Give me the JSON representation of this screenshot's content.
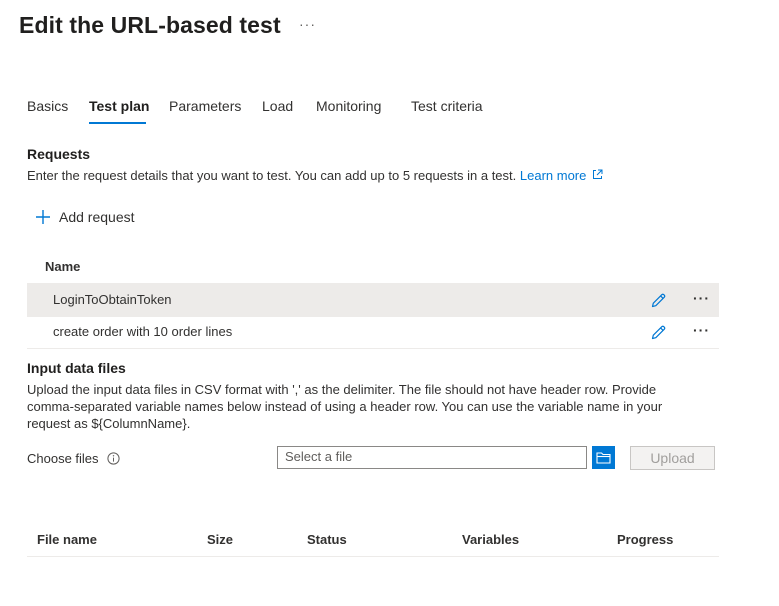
{
  "page": {
    "title": "Edit the URL-based test",
    "more_label": "···"
  },
  "tabs": [
    {
      "label": "Basics",
      "active": false
    },
    {
      "label": "Test plan",
      "active": true
    },
    {
      "label": "Parameters",
      "active": false
    },
    {
      "label": "Load",
      "active": false
    },
    {
      "label": "Monitoring",
      "active": false
    },
    {
      "label": "Test criteria",
      "active": false
    }
  ],
  "requests": {
    "title": "Requests",
    "description": "Enter the request details that you want to test. You can add up to 5 requests in a test.",
    "learn_more": "Learn more",
    "add_request": "Add request",
    "column_name": "Name",
    "rows": [
      {
        "name": "LoginToObtainToken",
        "selected": true
      },
      {
        "name": "create order with 10 order lines",
        "selected": false
      }
    ],
    "more_label": "···"
  },
  "input_files": {
    "title": "Input data files",
    "description_1": "Upload the input data files in CSV format with ',' as the delimiter. The file should not have header row. Provide",
    "description_2": "comma-separated variable names below instead of using a header row. You can use the variable name in your",
    "description_3": "request as ${ColumnName}.",
    "choose_files_label": "Choose files",
    "file_placeholder": "Select a file",
    "upload_label": "Upload",
    "columns": {
      "file_name": "File name",
      "size": "Size",
      "status": "Status",
      "variables": "Variables",
      "progress": "Progress"
    }
  },
  "colors": {
    "accent": "#0078d4",
    "selected_row": "#edebe9",
    "disabled_text": "#a19f9d"
  }
}
